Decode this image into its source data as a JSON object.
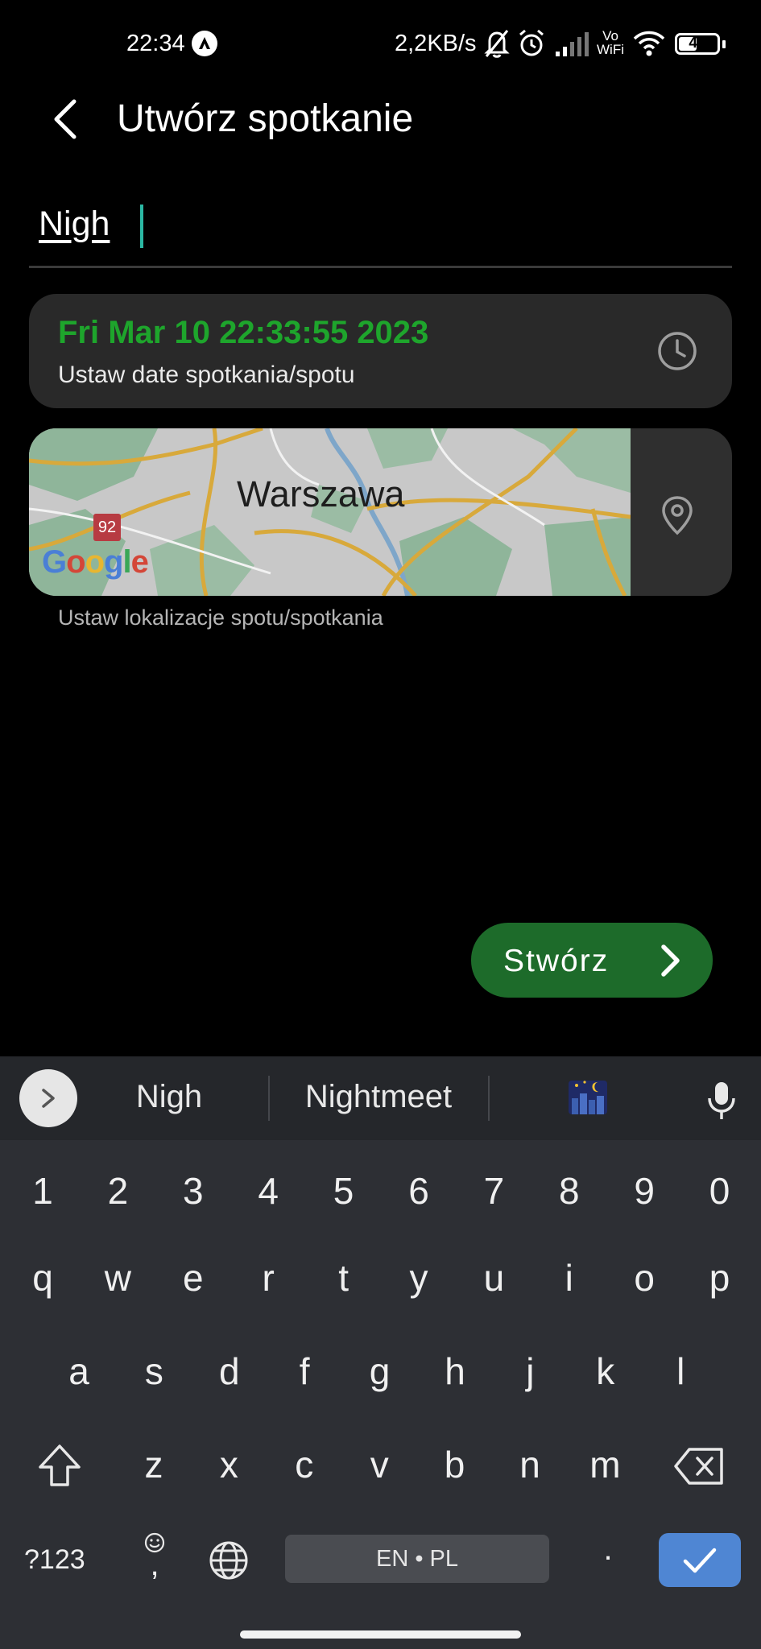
{
  "status_bar": {
    "time": "22:34",
    "network_speed": "2,2KB/s",
    "battery": "47",
    "battery_level_percent": 47,
    "icons": [
      "app-notification-icon",
      "bell-off-icon",
      "alarm-icon",
      "signal-icon",
      "vowifi-icon",
      "wifi-icon",
      "battery-icon"
    ],
    "vowifi_top": "Vo",
    "vowifi_bottom": "WiFi"
  },
  "header": {
    "title": "Utwórz spotkanie",
    "back_icon": "back-arrow-icon"
  },
  "form": {
    "name_value": "Nigh",
    "date": {
      "value": "Fri Mar 10 22:33:55 2023",
      "label": "Ustaw date spotkania/spotu",
      "icon": "clock-icon"
    },
    "location": {
      "map_city": "Warszawa",
      "map_logo": "Google",
      "road_number": "92",
      "label": "Ustaw lokalizacje spotu/spotkania",
      "icon": "location-pin-icon"
    },
    "create_label": "Stwórz"
  },
  "keyboard": {
    "suggestions": [
      "Nigh",
      "Nightmeet"
    ],
    "emoji_suggestion": "night-city-emoji",
    "number_row": [
      "1",
      "2",
      "3",
      "4",
      "5",
      "6",
      "7",
      "8",
      "9",
      "0"
    ],
    "row1": [
      "q",
      "w",
      "e",
      "r",
      "t",
      "y",
      "u",
      "i",
      "o",
      "p"
    ],
    "row2": [
      "a",
      "s",
      "d",
      "f",
      "g",
      "h",
      "j",
      "k",
      "l"
    ],
    "row3": [
      "z",
      "x",
      "c",
      "v",
      "b",
      "n",
      "m"
    ],
    "symbols_key": "?123",
    "comma_key": ",",
    "space_label": "EN • PL",
    "period_key": "."
  },
  "colors": {
    "accent_green": "#1ea52c",
    "button_green": "#1d6b2a",
    "card_bg": "#292929",
    "caret": "#2bb8a3",
    "enter_blue": "#4f86d3"
  }
}
